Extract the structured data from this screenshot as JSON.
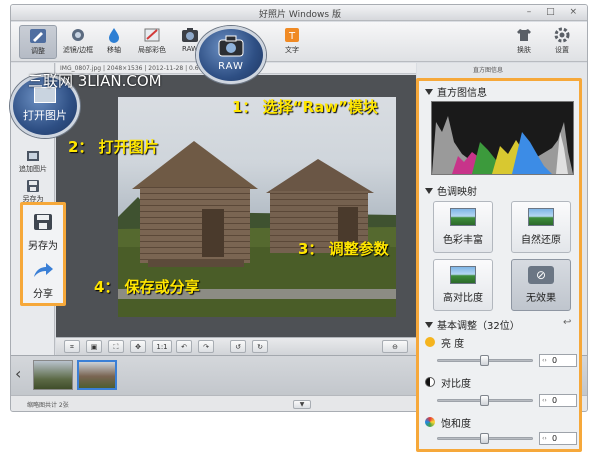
{
  "window": {
    "title": "好照片 Windows 版",
    "controls": "– □ ×"
  },
  "toolbar": {
    "items": [
      {
        "label": "调整",
        "icon": "adjust-pencil-icon",
        "active": true
      },
      {
        "label": "滤镜/边框",
        "icon": "filter-icon"
      },
      {
        "label": "移轴",
        "icon": "tilt-shift-icon"
      },
      {
        "label": "局部彩色",
        "icon": "partial-color-icon"
      },
      {
        "label": "RAW",
        "icon": "raw-camera-icon"
      },
      {
        "label": "文字",
        "icon": "text-icon"
      }
    ],
    "right_items": [
      {
        "label": "换肤",
        "icon": "skin-shirt-icon"
      },
      {
        "label": "设置",
        "icon": "gear-icon"
      }
    ]
  },
  "callouts": {
    "raw_label": "RAW",
    "open_label": "打开图片"
  },
  "watermark": "三联网 3LIAN.COM",
  "left_sidebar": {
    "items": [
      {
        "label": "追加图片",
        "icon": "add-image-icon"
      },
      {
        "label": "另存为",
        "icon": "save-as-icon"
      }
    ]
  },
  "save_panel": {
    "save_as": "另存为",
    "share": "分享"
  },
  "image_info": "IMG_0807.jpg | 2048×1536 | 2012-11-28 | 0.66M",
  "annotations": {
    "step1": "1： 选择“Raw”模块",
    "step2": "2： 打开图片",
    "step3": "3： 调整参数",
    "step4": "4： 保存或分享"
  },
  "bottom_toolbar": {
    "ratio": "1:1"
  },
  "right_header": "直方图信息",
  "panel": {
    "histogram_title": "直方图信息",
    "tone_title": "色调映射",
    "tones": [
      {
        "label": "色彩丰富"
      },
      {
        "label": "自然还原"
      },
      {
        "label": "高对比度"
      },
      {
        "label": "无效果",
        "selected": true
      }
    ],
    "basic_title": "基本调整（32位）",
    "adjustments": [
      {
        "label": "亮 度",
        "value": "0",
        "level_percent": 50
      },
      {
        "label": "对比度",
        "value": "0",
        "level_percent": 50
      },
      {
        "label": "饱和度",
        "value": "0",
        "level_percent": 50
      }
    ]
  },
  "statusbar": {
    "text": "缩略图共计 2张"
  },
  "colors": {
    "highlight": "#f6a83a",
    "annotation_text": "#ffe600",
    "callout_fill": "#2e4f84"
  }
}
